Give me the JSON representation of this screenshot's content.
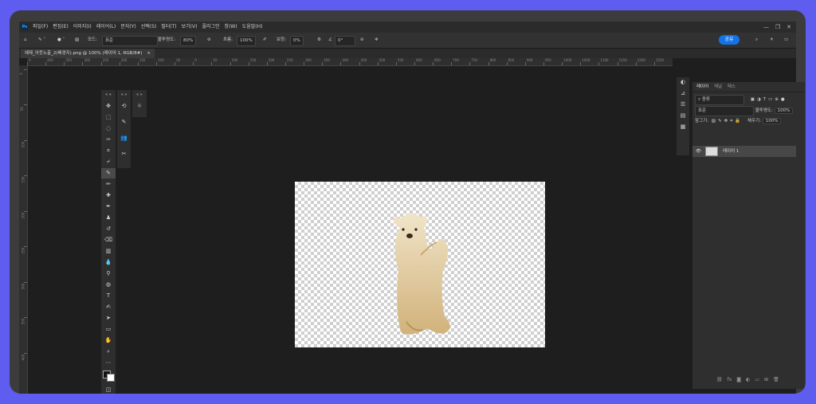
{
  "app": {
    "logo": "Ps"
  },
  "menu": [
    "파일(F)",
    "편집(E)",
    "이미지(I)",
    "레이어(L)",
    "문자(Y)",
    "선택(S)",
    "필터(T)",
    "보기(V)",
    "플러그인",
    "창(W)",
    "도움말(H)"
  ],
  "window_controls": [
    "—",
    "❐",
    "✕"
  ],
  "options": {
    "mode_label": "모드:",
    "mode_value": "표준",
    "opacity_label": "불투명도:",
    "opacity_value": "80%",
    "flow_label": "흐름:",
    "flow_value": "100%",
    "smooth_label": "보정:",
    "smooth_value": "0%",
    "angle_value": "0°",
    "share_label": "공유"
  },
  "document": {
    "tab_title": "예제_아웃노출_2(배경지).png @ 100% (레이어 1, RGB/8#)",
    "close": "×"
  },
  "ruler_top": [
    "0",
    "400",
    "350",
    "300",
    "250",
    "200",
    "150",
    "100",
    "50",
    "0",
    "50",
    "100",
    "150",
    "200",
    "250",
    "300",
    "350",
    "400",
    "450",
    "500",
    "550",
    "600",
    "650",
    "700",
    "750",
    "800",
    "850",
    "900",
    "950",
    "1000",
    "1050",
    "1100",
    "1150",
    "1200",
    "1250"
  ],
  "ruler_left": [
    "0",
    "50",
    "100",
    "150",
    "200",
    "250",
    "300",
    "350",
    "400"
  ],
  "layers_panel": {
    "tabs": [
      "레이어",
      "채널",
      "패스"
    ],
    "filter_label": "종류",
    "blend_mode": "표준",
    "opacity_label": "불투명도:",
    "opacity_value": "100%",
    "lock_label": "잠그기:",
    "fill_label": "채우기:",
    "fill_value": "100%",
    "layer_name": "레이어 1"
  }
}
